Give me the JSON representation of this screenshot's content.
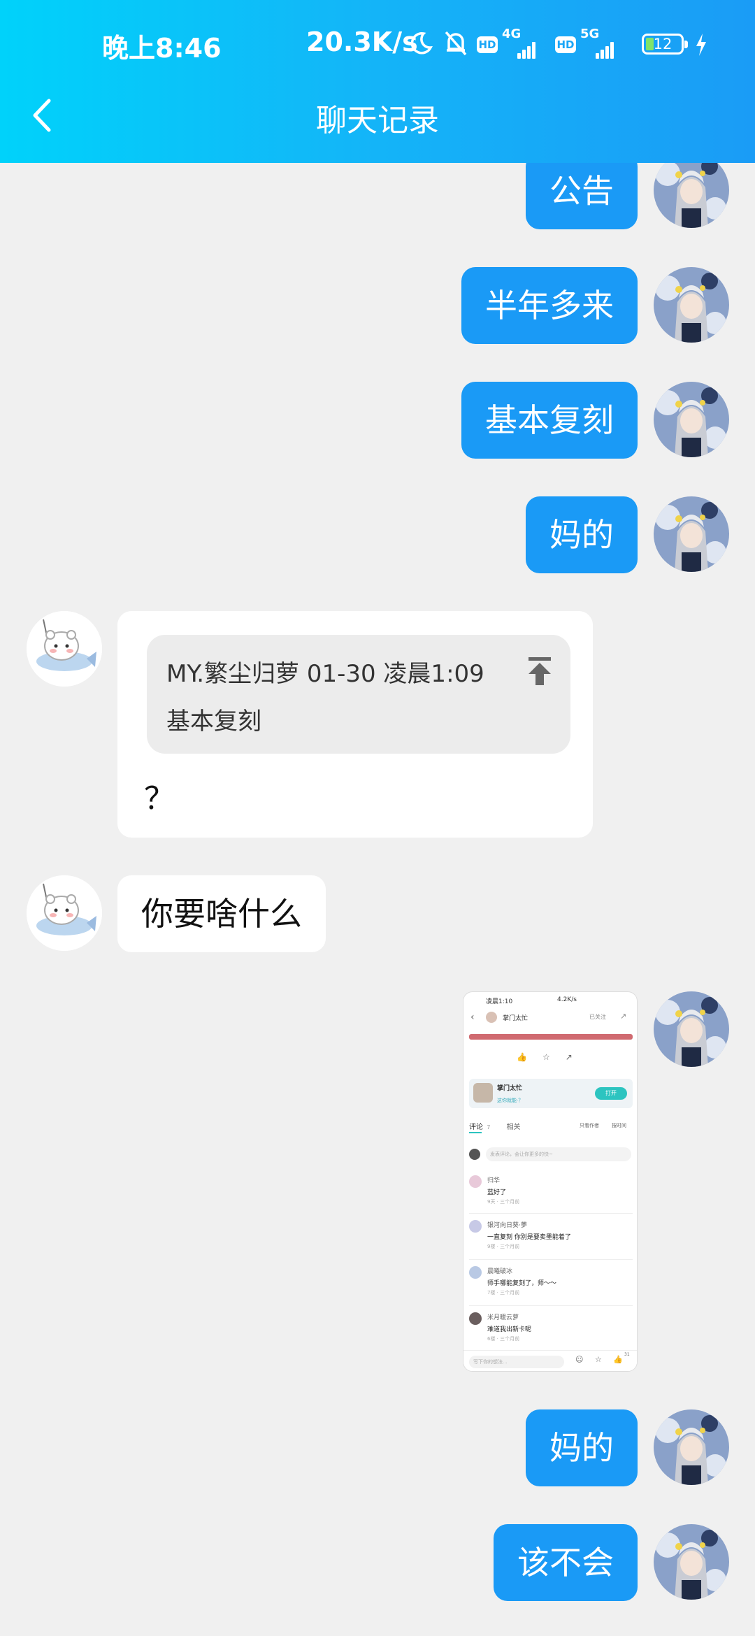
{
  "status_bar": {
    "time": "晚上8:46",
    "net_speed": "20.3K/s",
    "sim1_label": "4G",
    "sim2_label": "5G",
    "hd_label": "HD",
    "battery_level": "12"
  },
  "header": {
    "title": "聊天记录"
  },
  "messages": [
    {
      "side": "me",
      "text": "公告"
    },
    {
      "side": "me",
      "text": "半年多来"
    },
    {
      "side": "me",
      "text": "基本复刻"
    },
    {
      "side": "me",
      "text": "妈的"
    },
    {
      "side": "them",
      "quote_meta": "MY.繁尘归萝 01-30 凌晨1:09",
      "quote_text": "基本复刻",
      "text": "？"
    },
    {
      "side": "them",
      "text": "你要啥什么"
    },
    {
      "side": "me",
      "type": "image"
    },
    {
      "side": "me",
      "text": "妈的"
    },
    {
      "side": "me",
      "text": "该不会"
    }
  ],
  "embedded_screenshot": {
    "time": "凌晨1:10",
    "speed": "4.2K/s",
    "author": "掌门太忙",
    "follow": "已关注",
    "card_title": "掌门太忙",
    "card_sub": "这你就能·？",
    "open_btn": "打开",
    "tab_comments": "评论",
    "tab_comments_count": "7",
    "tab_related": "相关",
    "sort_hot": "只看作者",
    "sort_new": "按时间",
    "comment_placeholder": "发表评论，会让你更多的快~",
    "comments": [
      {
        "name": "归华",
        "text": "蓝好了",
        "time": "9天 · 三个月前"
      },
      {
        "name": "银河向日葵·夢",
        "text": "一直复刻 你别是要卖墨能着了",
        "time": "9楼 · 三个月前"
      },
      {
        "name": "晨曦破冰",
        "text": "师手哪能复刻了，师～～",
        "time": "7楼 · 三个月前"
      },
      {
        "name": "米月暖云萝",
        "text": "难道我出新卡呢",
        "time": "6楼 · 三个月前"
      }
    ],
    "input_placeholder": "写下你的想法...",
    "like_count": "31"
  }
}
